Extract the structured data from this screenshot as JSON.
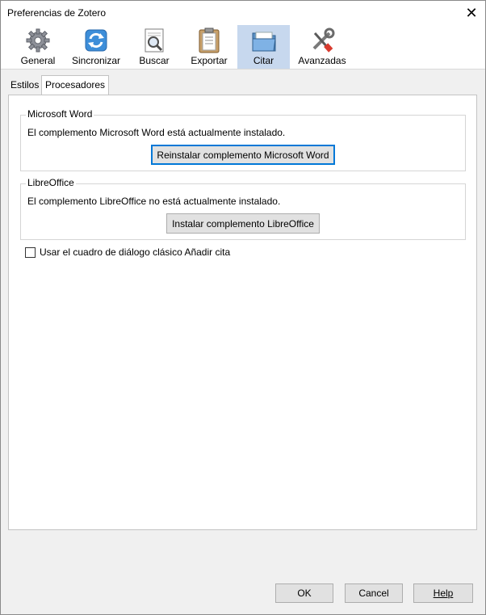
{
  "window": {
    "title": "Preferencias de Zotero"
  },
  "toolbar": {
    "panes": [
      {
        "label": "General",
        "icon": "gear-icon"
      },
      {
        "label": "Sincronizar",
        "icon": "sync-icon"
      },
      {
        "label": "Buscar",
        "icon": "search-icon"
      },
      {
        "label": "Exportar",
        "icon": "clipboard-icon"
      },
      {
        "label": "Citar",
        "icon": "folder-icon",
        "selected": true
      },
      {
        "label": "Avanzadas",
        "icon": "tools-icon"
      }
    ]
  },
  "tabs": [
    {
      "label": "Estilos"
    },
    {
      "label": "Procesadores de texto",
      "active": true
    }
  ],
  "word": {
    "legend": "Microsoft Word",
    "status": "El complemento Microsoft Word está actualmente instalado.",
    "button": "Reinstalar complemento Microsoft Word"
  },
  "libreoffice": {
    "legend": "LibreOffice",
    "status": "El complemento LibreOffice no está actualmente instalado.",
    "button": "Instalar complemento LibreOffice"
  },
  "classic_dialog": {
    "label": "Usar el cuadro de diálogo clásico Añadir cita",
    "checked": false
  },
  "footer": {
    "ok": "OK",
    "cancel": "Cancel",
    "help": "Help"
  },
  "colors": {
    "selected_pane": "#c7d8ee",
    "focus_border": "#0078d7",
    "button_bg": "#e1e1e1"
  }
}
